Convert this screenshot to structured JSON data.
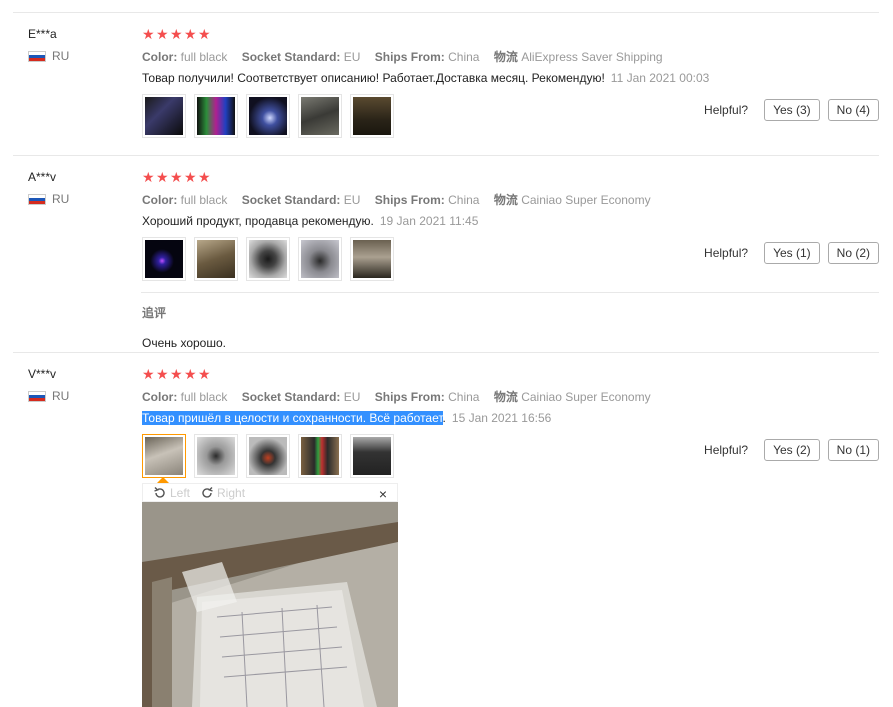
{
  "helpful_label": "Helpful?",
  "viewer": {
    "left_label": "Left",
    "right_label": "Right",
    "close_label": "×"
  },
  "reviews": [
    {
      "user": "E***a",
      "country": "RU",
      "rating": 5,
      "attrs": [
        {
          "k": "Color:",
          "v": "full black"
        },
        {
          "k": "Socket Standard:",
          "v": "EU"
        },
        {
          "k": "Ships From:",
          "v": "China"
        },
        {
          "k": "物流",
          "v": "AliExpress Saver Shipping"
        }
      ],
      "text": "Товар получили! Соответствует описанию! Работает.Доставка месяц. Рекомендую!",
      "date": "11 Jan 2021 00:03",
      "yes": "Yes (3)",
      "no": "No (4)"
    },
    {
      "user": "A***v",
      "country": "RU",
      "rating": 5,
      "attrs": [
        {
          "k": "Color:",
          "v": "full black"
        },
        {
          "k": "Socket Standard:",
          "v": "EU"
        },
        {
          "k": "Ships From:",
          "v": "China"
        },
        {
          "k": "物流",
          "v": "Cainiao Super Economy"
        }
      ],
      "text": "Хороший продукт, продавца рекомендую.",
      "date": "19 Jan 2021 11:45",
      "yes": "Yes (1)",
      "no": "No (2)",
      "additional_title": "追评",
      "additional_text": "Очень хорошо."
    },
    {
      "user": "V***v",
      "country": "RU",
      "rating": 5,
      "attrs": [
        {
          "k": "Color:",
          "v": "full black"
        },
        {
          "k": "Socket Standard:",
          "v": "EU"
        },
        {
          "k": "Ships From:",
          "v": "China"
        },
        {
          "k": "物流",
          "v": "Cainiao Super Economy"
        }
      ],
      "text": "Товар пришёл в целости и сохранности. Всё работает",
      "text_tail": ".",
      "date": "15 Jan 2021 16:56",
      "yes": "Yes (2)",
      "no": "No (1)"
    }
  ]
}
